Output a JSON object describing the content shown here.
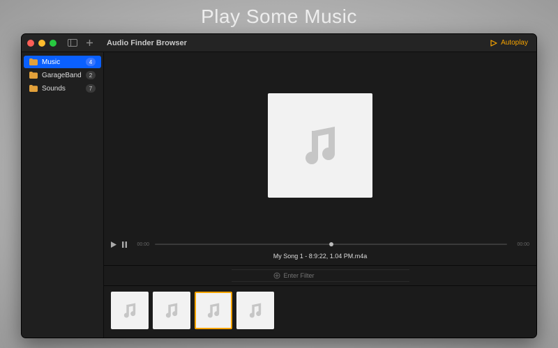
{
  "hero_title": "Play Some Music",
  "window": {
    "title": "Audio Finder Browser"
  },
  "autoplay": {
    "label": "Autoplay"
  },
  "sidebar": {
    "items": [
      {
        "label": "Music",
        "count": "4",
        "selected": true
      },
      {
        "label": "GarageBand",
        "count": "2",
        "selected": false
      },
      {
        "label": "Sounds",
        "count": "7",
        "selected": false
      }
    ]
  },
  "transport": {
    "time_elapsed": "00:00",
    "time_total": "00:00",
    "now_playing": "My Song 1 - 8:9:22, 1.04 PM.m4a"
  },
  "filter": {
    "placeholder": "Enter Filter"
  },
  "thumbs": [
    {
      "selected": false
    },
    {
      "selected": false
    },
    {
      "selected": true
    },
    {
      "selected": false
    }
  ]
}
